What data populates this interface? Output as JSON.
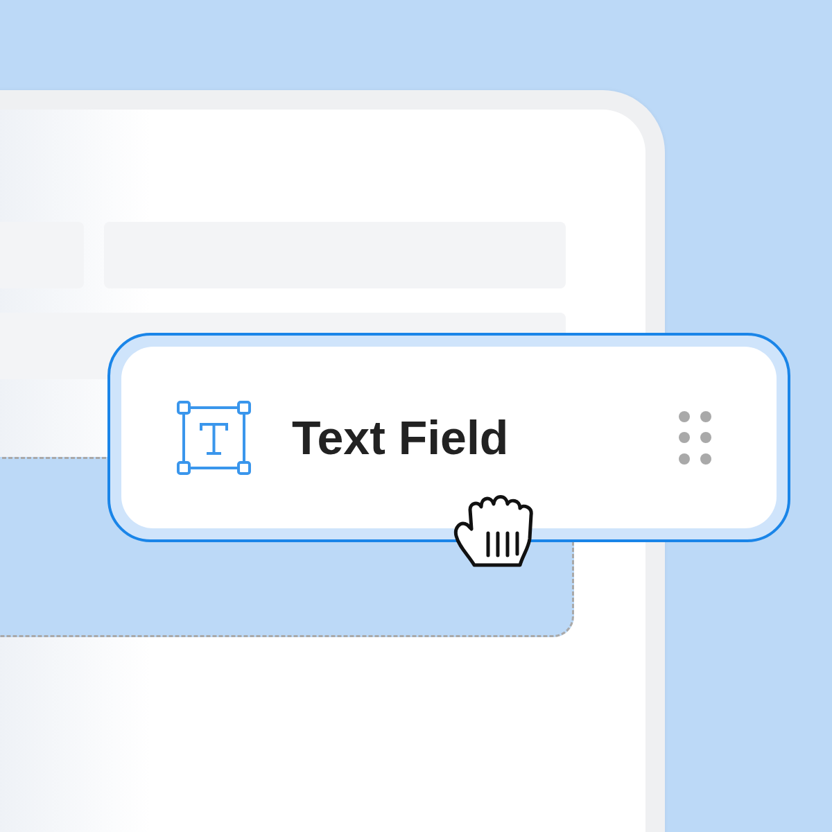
{
  "dragged_field": {
    "label": "Text Field"
  }
}
